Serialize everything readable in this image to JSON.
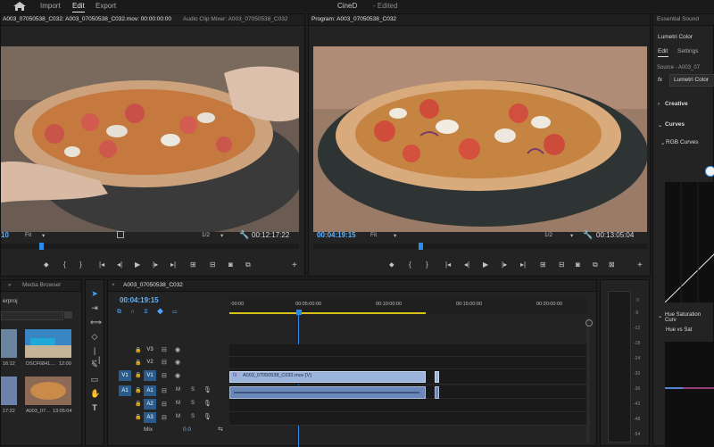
{
  "app": {
    "title": "CineD",
    "status": "- Edited",
    "nav": [
      "Import",
      "Edit",
      "Export"
    ],
    "active_nav": "Edit"
  },
  "source_monitor": {
    "tabs": [
      "A003_07050538_C032: A003_07050538_C032.mov: 00:00:00:00",
      "Audio Clip Mixer: A003_07050538_C032"
    ],
    "timecode_left": "10",
    "fit": "Fit",
    "resolution": "1/2",
    "timecode_right": "00:12:17:22"
  },
  "program_monitor": {
    "tab": "Program: A003_07050538_C032",
    "timecode_left": "00:04:19:15",
    "fit": "Fit",
    "resolution": "1/2",
    "timecode_right": "00:13:05:04"
  },
  "project_panel": {
    "tabs": [
      "Media Browser"
    ],
    "file": "erproj",
    "thumbs": [
      {
        "name": "",
        "duration": "16:12"
      },
      {
        "name": "DSCF6841....",
        "duration": "12:00"
      },
      {
        "name": "",
        "duration": "17:22"
      },
      {
        "name": "A003_07...",
        "duration": "13:05:04"
      }
    ]
  },
  "timeline": {
    "tab": "A003_07050538_C032",
    "timecode": "00:04:19:15",
    "ruler": [
      ":00:00",
      "00:05:00:00",
      "00:10:00:00",
      "00:15:00:00",
      "00:20:00:00"
    ],
    "video_tracks": [
      "V3",
      "V2",
      "V1"
    ],
    "audio_tracks": [
      "A1",
      "A2",
      "A3"
    ],
    "target_v": "V1",
    "target_a": "A1",
    "mix_label": "Mix",
    "mix_value": "0.0",
    "video_clip": "A003_07050538_C032.mov [V]",
    "meter_scale": [
      "0",
      "-6",
      "-12",
      "-18",
      "-24",
      "-30",
      "-36",
      "-42",
      "-48",
      "-54"
    ]
  },
  "essential_sound": {
    "tab": "Essential Sound",
    "lumetri_title": "Lumetri Color",
    "lumetri_tabs": [
      "Edit",
      "Settings"
    ],
    "source": "Source - A003_07",
    "fx": "fx",
    "effect": "Lumetri Color",
    "creative": "Creative",
    "curves": "Curves",
    "rgb_curves": "RGB Curves",
    "hue_sat": "Hue Saturation Curv",
    "hue_vs_sat": "Hue vs Sat"
  },
  "icons": [
    "home-icon",
    "play-icon",
    "wrench-icon",
    "marker-icon",
    "step-back-icon",
    "step-forward-icon",
    "camera-icon",
    "plus-icon",
    "selection-tool-icon",
    "razor-tool-icon",
    "hand-tool-icon",
    "type-tool-icon",
    "pen-tool-icon",
    "lock-icon",
    "eye-icon",
    "mic-icon"
  ]
}
